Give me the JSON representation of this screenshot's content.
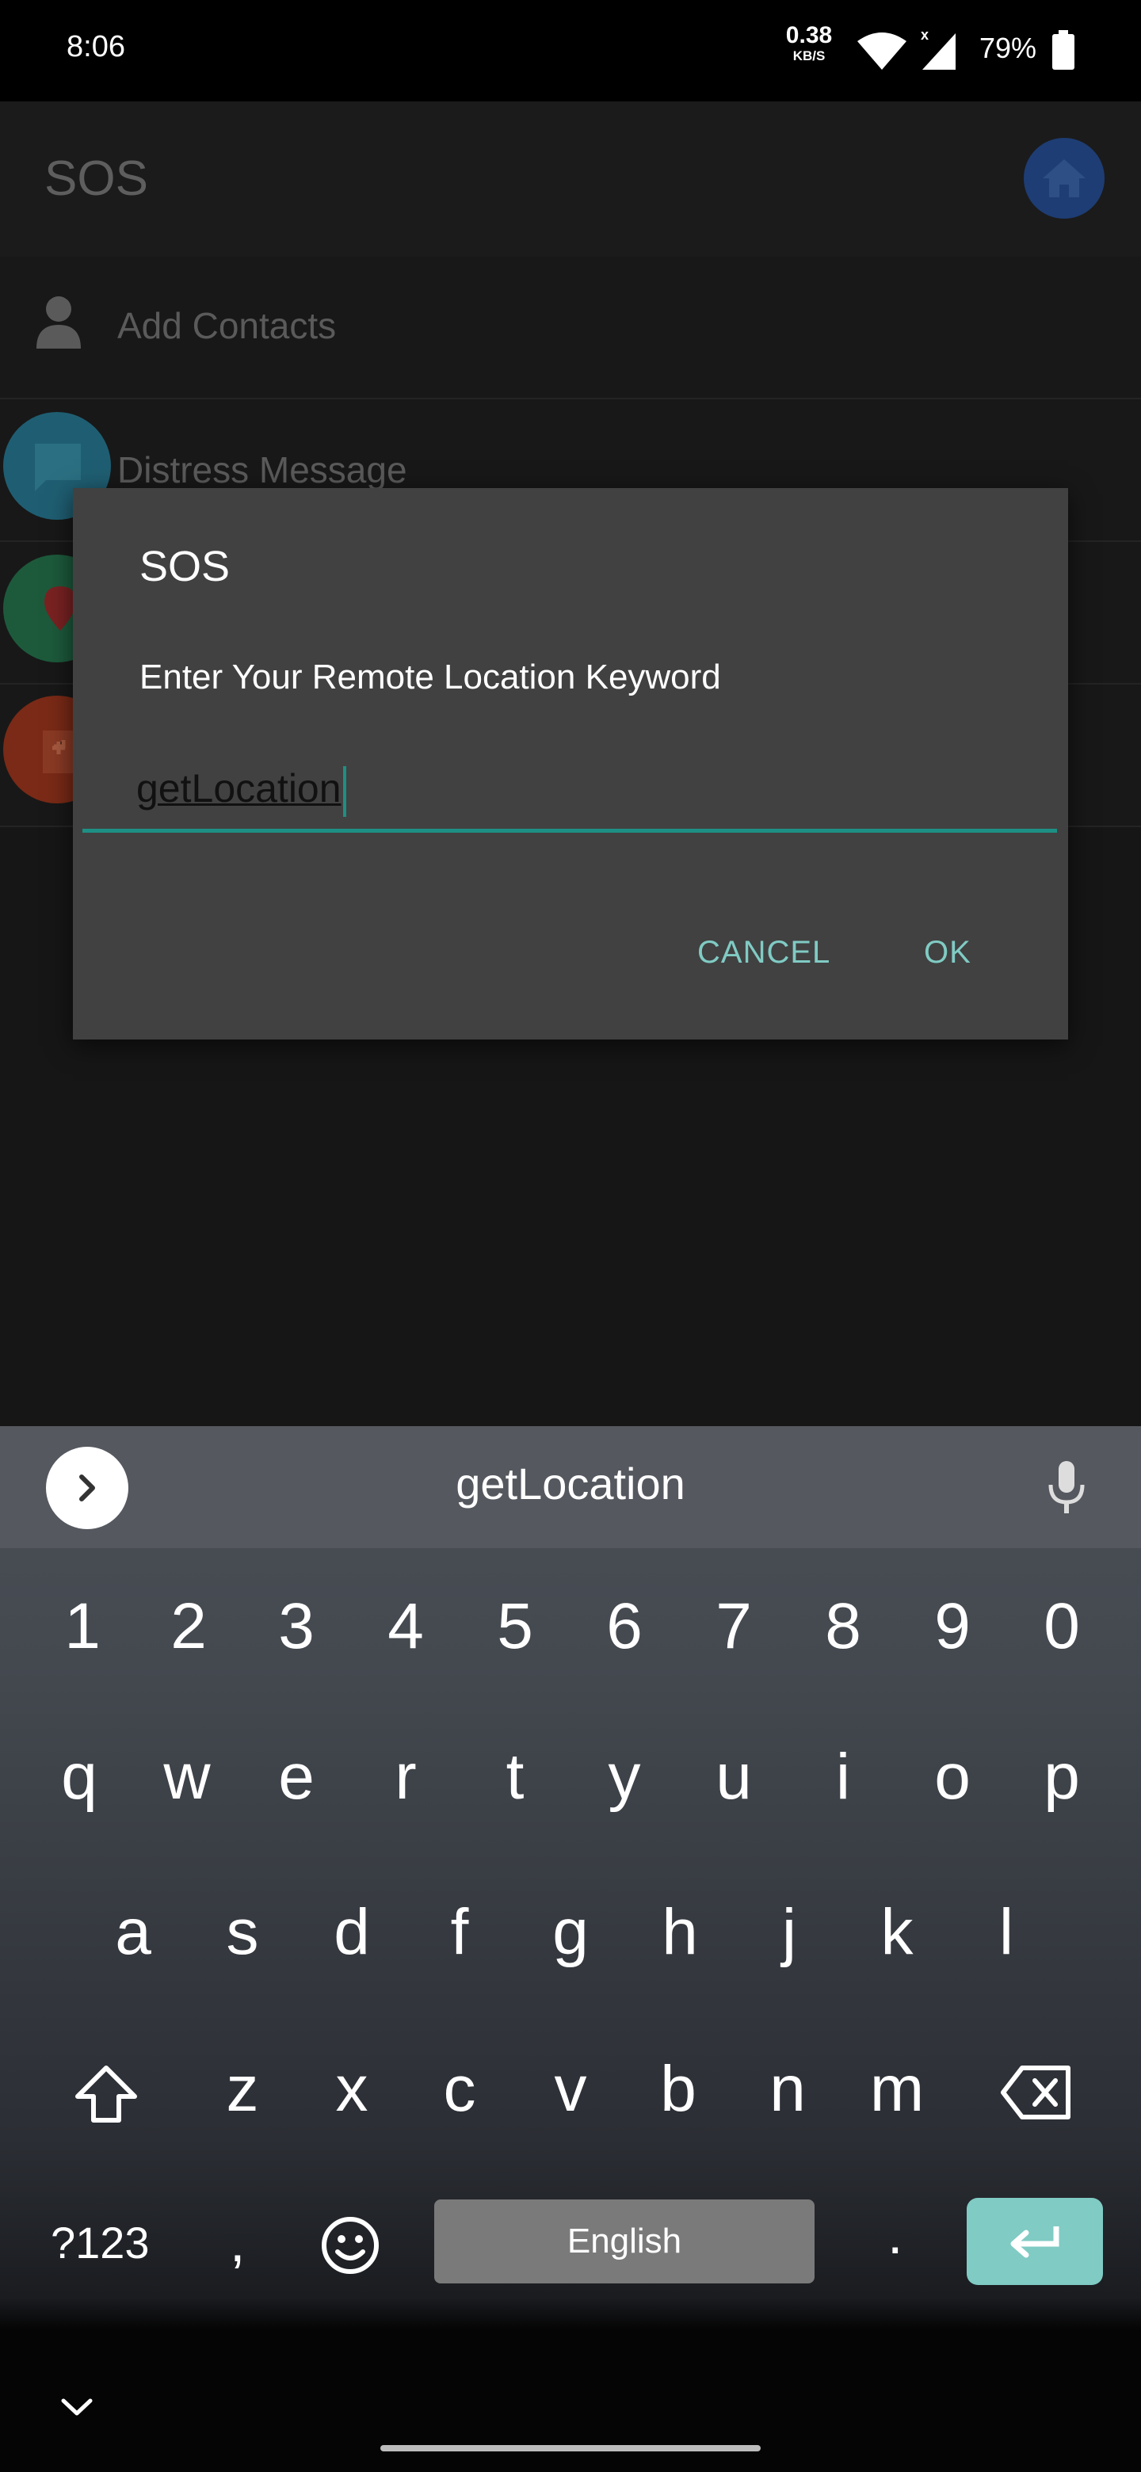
{
  "status_bar": {
    "time": "8:06",
    "speed_value": "0.38",
    "speed_unit": "KB/S",
    "battery": "79%"
  },
  "app": {
    "title": "SOS",
    "items": [
      {
        "label": "Add Contacts",
        "icon": "person-icon"
      },
      {
        "label": "Distress Message",
        "icon": "message-icon"
      },
      {
        "label": "",
        "icon": "location-pin-icon"
      },
      {
        "label": "",
        "icon": "medical-icon"
      }
    ]
  },
  "dialog": {
    "title": "SOS",
    "message": "Enter Your Remote Location Keyword",
    "input_value": "getLocation",
    "cancel_label": "CANCEL",
    "ok_label": "OK",
    "accent_color": "#80cbc4"
  },
  "keyboard": {
    "suggestion": "getLocation",
    "number_row": [
      "1",
      "2",
      "3",
      "4",
      "5",
      "6",
      "7",
      "8",
      "9",
      "0"
    ],
    "row1": [
      "q",
      "w",
      "e",
      "r",
      "t",
      "y",
      "u",
      "i",
      "o",
      "p"
    ],
    "row2": [
      "a",
      "s",
      "d",
      "f",
      "g",
      "h",
      "j",
      "k",
      "l"
    ],
    "row3": [
      "z",
      "x",
      "c",
      "v",
      "b",
      "n",
      "m"
    ],
    "symbols_label": "?123",
    "comma": ",",
    "space_label": "English",
    "period": "."
  }
}
